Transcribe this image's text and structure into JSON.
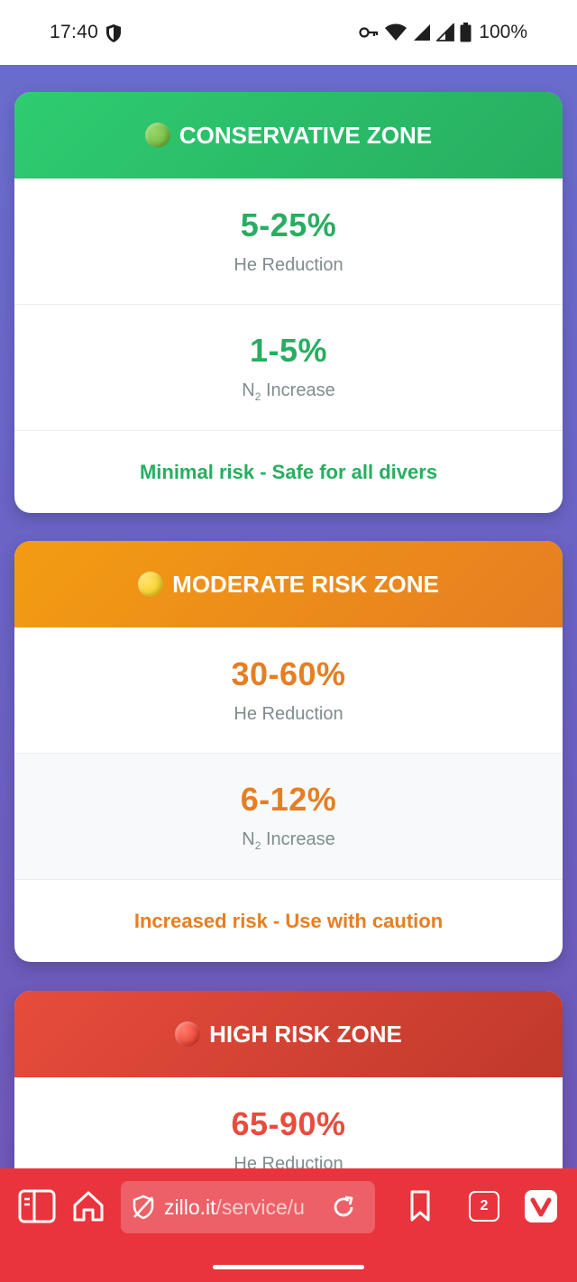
{
  "status_bar": {
    "time": "17:40",
    "battery": "100%",
    "icons": [
      "shield-icon",
      "vpn-key-icon",
      "wifi-icon",
      "signal-icon",
      "signal-icon",
      "battery-icon"
    ]
  },
  "zones": {
    "conservative": {
      "title": "CONSERVATIVE ZONE",
      "color": "#27ae60",
      "he_value": "5-25%",
      "he_label": "He Reduction",
      "n2_value": "1-5%",
      "n2_label_prefix": "N",
      "n2_label_sub": "2",
      "n2_label_suffix": " Increase",
      "note": "Minimal risk - Safe for all divers"
    },
    "moderate": {
      "title": "MODERATE RISK ZONE",
      "color": "#e67e22",
      "he_value": "30-60%",
      "he_label": "He Reduction",
      "n2_value": "6-12%",
      "n2_label_prefix": "N",
      "n2_label_sub": "2",
      "n2_label_suffix": " Increase",
      "note": "Increased risk - Use with caution"
    },
    "high": {
      "title": "HIGH RISK ZONE",
      "color": "#e74c3c",
      "he_value": "65-90%",
      "he_label": "He Reduction"
    }
  },
  "browser": {
    "url_domain": "zillo.it",
    "url_path": "/service/u",
    "tab_count": "2",
    "accent": "#ea343d"
  }
}
